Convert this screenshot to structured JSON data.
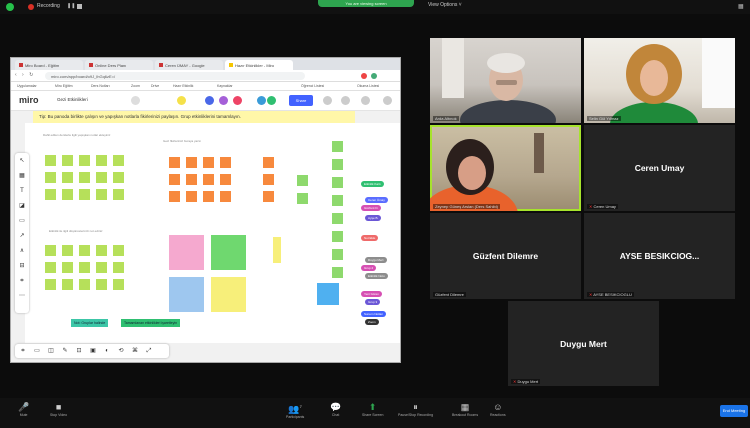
{
  "top_bar": {
    "recording_label": "Recording",
    "pause_glyph": "❚❚",
    "share_banner": "You are viewing screen",
    "view_options": "View Options ˅",
    "grid_glyph": "▦"
  },
  "browser": {
    "tabs": [
      {
        "label": "Miro Board - Eğitim"
      },
      {
        "label": "Online Ders Planı"
      },
      {
        "label": "Ceren ÜMAY - Google"
      },
      {
        "label": "Hazır Etkinlikler - Miro"
      }
    ],
    "url": "miro.com/app/board/o9J_lhGq6zE=/",
    "nav_glyphs": "‹ › ↻",
    "bookmarks": [
      "Uygulamalar",
      "Miro Eğitim",
      "Ders Notları",
      "Zoom",
      "Drive",
      "Hazır Etkinlik",
      "Kaynaklar",
      "Öğrenci Listesi",
      "Okuma Listesi"
    ]
  },
  "miro": {
    "logo": "miro",
    "board_name": "Gezi Etkinlikleri",
    "share_label": "Share",
    "tip": "Tip: Bu panoda birlikte çalışın ve yapışkan notlarla fikirlerinizi paylaşın. Grup etkinliklerini tamamlayın.",
    "group_notes": [
      "Dahil edilen derslerle ilgili yapışkan notlar ekleyiniz",
      "Gezi fikirlerinizi buraya yazın",
      "Etkinlik ile ilgili düşüncelerinizi not ediniz"
    ],
    "teal_note_1": "Not: Gruplar halinde",
    "teal_note_2": "Tamamlanan etkinlikleri işaretleyin",
    "left_tools": [
      "↖",
      "▦",
      "T",
      "◪",
      "▭",
      "↗",
      "∧",
      "⊟",
      "⌗",
      "⋯"
    ],
    "bottom_tools": [
      "⌗",
      "▭",
      "◫",
      "✎",
      "⊡",
      "▣",
      "◐",
      "⟲",
      "⌘",
      "⤢"
    ],
    "side_pills": [
      {
        "label": "Etkinlik Kartı",
        "color": "#2fbf71"
      },
      {
        "label": "Ceren Ümay",
        "color": "#5a6dff"
      },
      {
        "label": "Güzfent D.",
        "color": "#d64fb3"
      },
      {
        "label": "Ayşe B.",
        "color": "#6b57d6"
      },
      {
        "label": "Not Ekle",
        "color": "#ef6a6a"
      },
      {
        "label": "Duygu Mert",
        "color": "#8d8d8d"
      },
      {
        "label": "Grup 2",
        "color": "#d64fb3"
      },
      {
        "label": "Etkinlik Notu",
        "color": "#8d8d8d"
      },
      {
        "label": "Yeni Görev",
        "color": "#d64fb3"
      },
      {
        "label": "Grup 3",
        "color": "#6b57d6"
      },
      {
        "label": "Sunum Notları",
        "color": "#4262ff"
      },
      {
        "label": "Zoom",
        "color": "#333"
      }
    ]
  },
  "participants": [
    {
      "name": "Arda Altınok",
      "type": "video"
    },
    {
      "name": "Selin Gül Yılmaz",
      "type": "video"
    },
    {
      "name": "Zeynep Güneş Arslan (Ders Sahibi)",
      "type": "video",
      "speaking": true
    },
    {
      "name": "Ceren Umay",
      "caption": "Ceren Umay",
      "type": "avatar"
    },
    {
      "name": "Güzfent Dilemre",
      "caption": "Güzfent Dilemre",
      "type": "avatar"
    },
    {
      "name": "AYSE BESIKCIOG...",
      "caption": "AYSE BESIKCIOGLU",
      "type": "avatar"
    },
    {
      "name": "Duygu Mert",
      "caption": "Duygu Mert",
      "type": "avatar"
    }
  ],
  "controls": {
    "mute": {
      "glyph": "🎤",
      "label": "Mute"
    },
    "video": {
      "glyph": "■",
      "label": "Stop Video"
    },
    "participants": {
      "glyph": "👥",
      "label": "Participants",
      "count": "7"
    },
    "chat": {
      "glyph": "💬",
      "label": "Chat"
    },
    "share": {
      "glyph": "⬆",
      "label": "Share Screen"
    },
    "record": {
      "glyph": "⏸",
      "label": "Pause/Stop Recording"
    },
    "breakout": {
      "glyph": "▦",
      "label": "Breakout Rooms"
    },
    "reactions": {
      "glyph": "☺",
      "label": "Reactions"
    },
    "end": "End Meeting"
  }
}
